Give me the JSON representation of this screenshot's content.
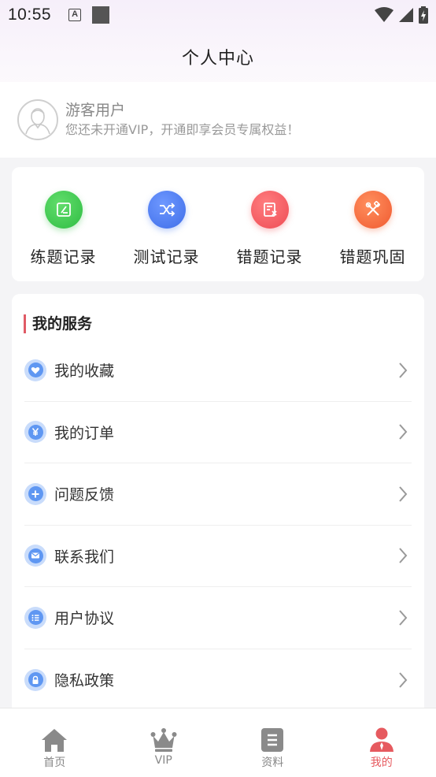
{
  "status_bar": {
    "time": "10:55",
    "notif_letter": "A"
  },
  "header": {
    "title": "个人中心"
  },
  "profile": {
    "name": "游客用户",
    "description": "您还未开通VIP，开通即享会员专属权益！"
  },
  "records": [
    {
      "label": "练题记录",
      "icon": "edit-square-icon",
      "color": "#3cc44c"
    },
    {
      "label": "测试记录",
      "icon": "shuffle-icon",
      "color": "#4a7af0"
    },
    {
      "label": "错题记录",
      "icon": "wrong-record-icon",
      "color": "#f0545a"
    },
    {
      "label": "错题巩固",
      "icon": "tools-icon",
      "color": "#f4693d"
    }
  ],
  "services": {
    "title": "我的服务",
    "items": [
      {
        "label": "我的收藏",
        "icon": "heart-icon"
      },
      {
        "label": "我的订单",
        "icon": "yuan-icon"
      },
      {
        "label": "问题反馈",
        "icon": "plus-icon"
      },
      {
        "label": "联系我们",
        "icon": "mail-icon"
      },
      {
        "label": "用户协议",
        "icon": "list-icon"
      },
      {
        "label": "隐私政策",
        "icon": "lock-icon"
      }
    ]
  },
  "tabbar": {
    "tabs": [
      {
        "label": "首页",
        "icon": "home-icon"
      },
      {
        "label": "VIP",
        "icon": "crown-icon"
      },
      {
        "label": "资料",
        "icon": "document-icon"
      },
      {
        "label": "我的",
        "icon": "user-icon"
      }
    ],
    "active_color": "#e65a5f",
    "inactive_color": "#888888"
  }
}
